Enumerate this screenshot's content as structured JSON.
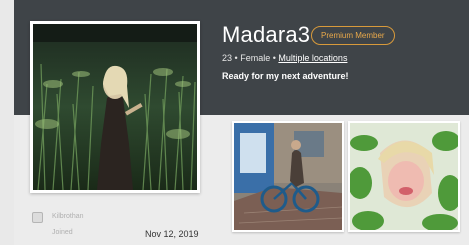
{
  "profile": {
    "username": "Madara3",
    "badge": "Premium Member",
    "age": "23",
    "gender": "Female",
    "separator": "•",
    "location": "Multiple locations",
    "tagline": "Ready for my next adventure!"
  },
  "meta": {
    "label_1": "Kilbrothan",
    "label_2": "Joined",
    "date": "Nov 12, 2019"
  },
  "colors": {
    "header_bg": "#3f4448",
    "badge_accent": "#d89a3b",
    "page_bg": "#e9e9e9"
  },
  "photos": {
    "main": "profile-photo-woman-in-tall-grass",
    "thumb_1": "photo-person-with-bicycle-on-street",
    "thumb_2": "photo-blurred-selfie-with-leaves"
  }
}
